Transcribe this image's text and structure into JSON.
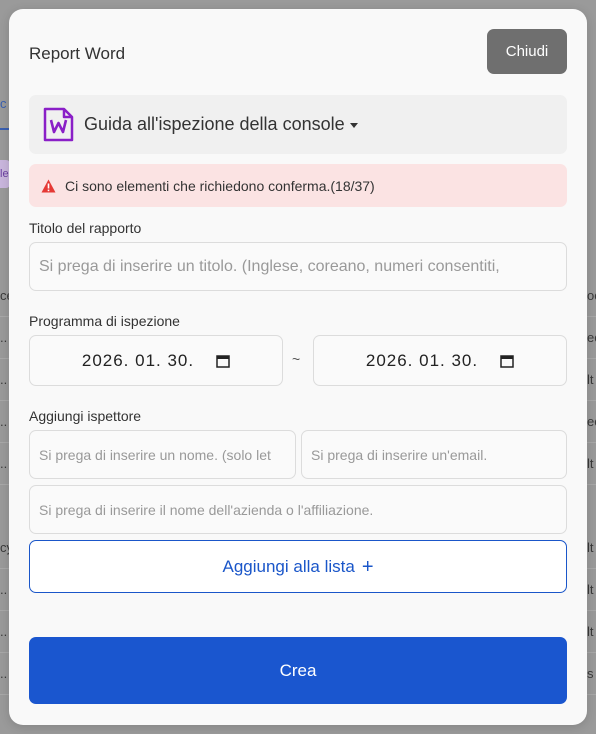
{
  "background": {
    "tab_partial": "c",
    "badge_partial": "le",
    "rows": [
      {
        "left": "ce",
        "right": "oc"
      },
      {
        "left": "..",
        "right": "ec"
      },
      {
        "left": "..",
        "right": "lt"
      },
      {
        "left": "..",
        "right": "ec"
      },
      {
        "left": "..",
        "right": "lt"
      },
      {
        "left": "cy",
        "right": "lt"
      },
      {
        "left": "..",
        "right": "lt"
      },
      {
        "left": "..",
        "right": "lt"
      },
      {
        "left": "..",
        "right": "s"
      }
    ]
  },
  "modal": {
    "title": "Report Word",
    "close_label": "Chiudi",
    "document_select": {
      "label": "Guida all'ispezione della console",
      "icon": "word-document-icon"
    },
    "alert": {
      "icon": "warning-triangle-icon",
      "text": "Ci sono elementi che richiedono conferma.(18/37)"
    },
    "report_title": {
      "label": "Titolo del rapporto",
      "placeholder": "Si prega di inserire un titolo. (Inglese, coreano, numeri consentiti,"
    },
    "schedule": {
      "label": "Programma di ispezione",
      "start_date": "2026. 01. 30.",
      "end_date": "2026. 01. 30.",
      "separator": "~"
    },
    "inspector": {
      "label": "Aggiungi ispettore",
      "name_placeholder": "Si prega di inserire un nome. (solo let",
      "email_placeholder": "Si prega di inserire un'email.",
      "company_placeholder": "Si prega di inserire il nome dell'azienda o l'affiliazione.",
      "add_label": "Aggiungi alla lista",
      "add_icon": "+"
    },
    "create_label": "Crea"
  },
  "colors": {
    "primary": "#1a56cf",
    "alert_bg": "#fbe3e3",
    "warning": "#e53935",
    "word_purple": "#8a1fc7"
  }
}
